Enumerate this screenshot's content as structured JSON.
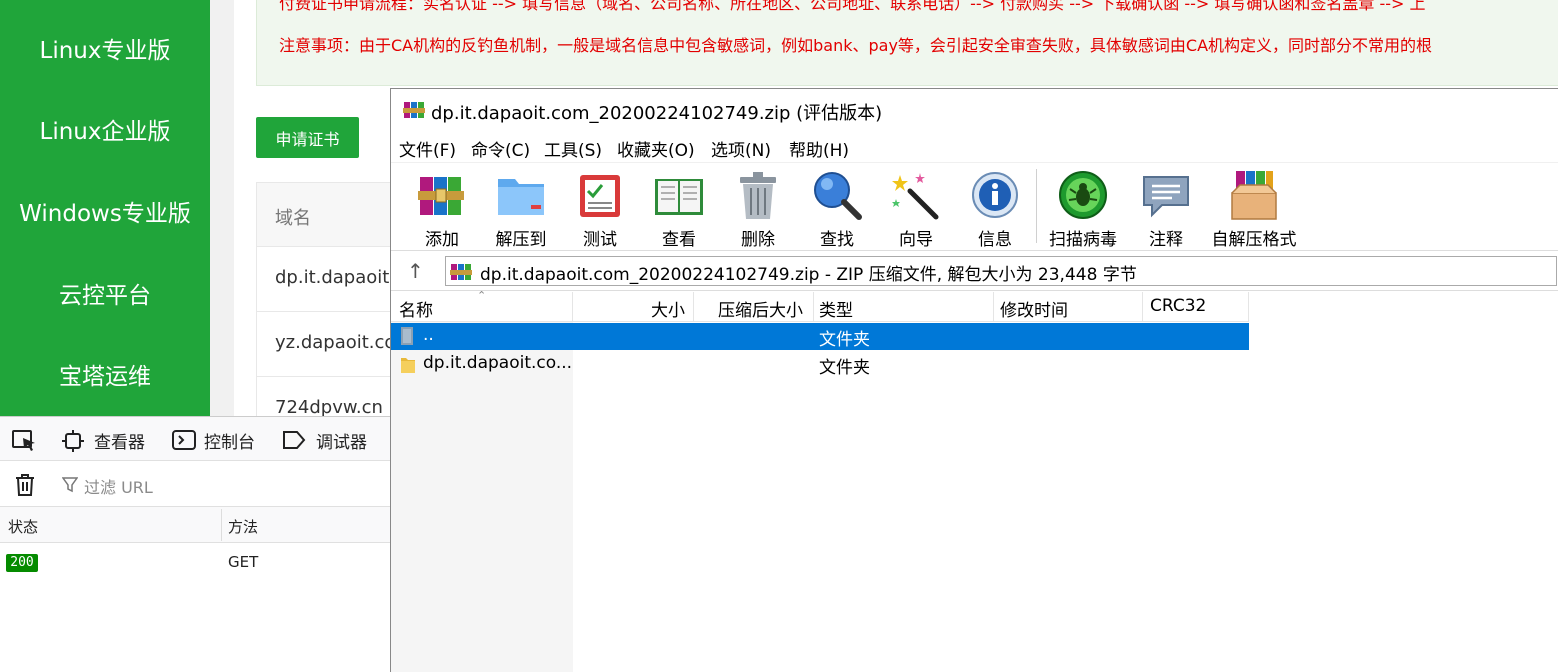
{
  "sidebar": {
    "items": [
      {
        "label": "Linux专业版"
      },
      {
        "label": "Linux企业版"
      },
      {
        "label": "Windows专业版"
      },
      {
        "label": "云控平台"
      },
      {
        "label": "宝塔运维"
      }
    ]
  },
  "page": {
    "notice_line1": "付费证书申请流程：实名认证 --> 填写信息（域名、公司名称、所在地区、公司地址、联系电话）--> 付款购买 --> 下载确认函 --> 填写确认函和签名盖章 --> 上",
    "notice_line2": "注意事项：由于CA机构的反钓鱼机制，一般是域名信息中包含敏感词，例如bank、pay等，会引起安全审查失败，具体敏感词由CA机构定义，同时部分不常用的根",
    "apply_button": "申请证书",
    "table_header": "域名",
    "domains": [
      "dp.it.dapaoit",
      "yz.dapaoit.co",
      "724dpvw.cn"
    ]
  },
  "devtools": {
    "tabs": {
      "inspector": "查看器",
      "console": "控制台",
      "debugger": "调试器"
    },
    "filter_placeholder": "过滤 URL",
    "columns": {
      "status": "状态",
      "method": "方法"
    },
    "request": {
      "status": "200",
      "method": "GET"
    }
  },
  "winrar": {
    "title": "dp.it.dapaoit.com_20200224102749.zip (评估版本)",
    "menu": [
      "文件(F)",
      "命令(C)",
      "工具(S)",
      "收藏夹(O)",
      "选项(N)",
      "帮助(H)"
    ],
    "toolbar": [
      {
        "label": "添加",
        "icon": "add-archive-icon"
      },
      {
        "label": "解压到",
        "icon": "extract-to-icon"
      },
      {
        "label": "测试",
        "icon": "test-icon"
      },
      {
        "label": "查看",
        "icon": "view-book-icon"
      },
      {
        "label": "删除",
        "icon": "trash-icon"
      },
      {
        "label": "查找",
        "icon": "find-magnifier-icon"
      },
      {
        "label": "向导",
        "icon": "wizard-wand-icon"
      },
      {
        "label": "信息",
        "icon": "info-icon"
      },
      {
        "label": "扫描病毒",
        "icon": "virus-scan-icon"
      },
      {
        "label": "注释",
        "icon": "comment-icon"
      },
      {
        "label": "自解压格式",
        "icon": "sfx-icon"
      }
    ],
    "address": "dp.it.dapaoit.com_20200224102749.zip - ZIP 压缩文件, 解包大小为 23,448 字节",
    "columns": [
      "名称",
      "大小",
      "压缩后大小",
      "类型",
      "修改时间",
      "CRC32"
    ],
    "rows": [
      {
        "name": "..",
        "type": "文件夹",
        "selected": true
      },
      {
        "name": "dp.it.dapaoit.co...",
        "type": "文件夹",
        "selected": false
      }
    ],
    "colors": {
      "selection": "#0078d7",
      "brand_green": "#20a53a",
      "notice_red": "#e20000"
    }
  }
}
